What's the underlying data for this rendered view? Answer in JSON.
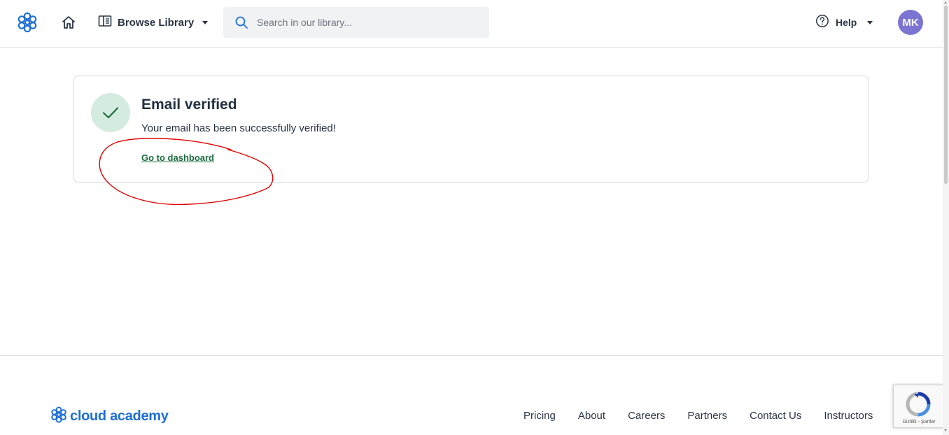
{
  "header": {
    "browse_label": "Browse Library",
    "search_placeholder": "Search in our library...",
    "help_label": "Help",
    "avatar_initials": "MK"
  },
  "card": {
    "title": "Email verified",
    "message": "Your email has been successfully verified!",
    "link_label": "Go to dashboard"
  },
  "footer": {
    "brand": "cloud academy",
    "links": [
      "Pricing",
      "About",
      "Careers",
      "Partners",
      "Contact Us",
      "Instructors"
    ]
  },
  "recaptcha": {
    "text": "Gizlilik - Şartlar"
  },
  "colors": {
    "brand_blue": "#1f6fd6",
    "avatar_purple": "#7b74d3",
    "success_green": "#1c6b3f",
    "annotation_red": "#e00000"
  }
}
